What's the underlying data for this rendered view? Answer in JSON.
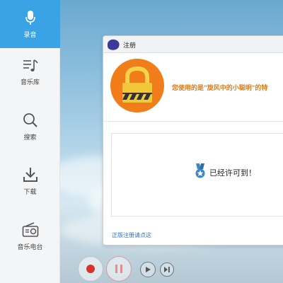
{
  "sidebar": {
    "items": [
      {
        "label": "录音",
        "icon": "microphone-icon",
        "active": true
      },
      {
        "label": "音乐库",
        "icon": "music-library-icon",
        "active": false
      },
      {
        "label": "搜索",
        "icon": "search-icon",
        "active": false
      },
      {
        "label": "下载",
        "icon": "download-icon",
        "active": false
      },
      {
        "label": "音乐电台",
        "icon": "radio-icon",
        "active": false
      }
    ]
  },
  "player": {
    "controls": [
      "record-icon",
      "pause-icon",
      "play-icon",
      "next-icon"
    ],
    "record_color": "#d8322e",
    "pause_color": "#e58c8c"
  },
  "dialog": {
    "title": "注册",
    "lock_icon": "padlock-icon",
    "message": "您使用的是\"旋风中的小聪明\"的特",
    "status_icon": "medal-icon",
    "status_text": "已经许可到！",
    "link_text": "正版注册请点这"
  },
  "colors": {
    "accent": "#39a3e6",
    "message": "#e07b13",
    "lock_bg": "#f07d1a",
    "link": "#2b6fbf"
  }
}
